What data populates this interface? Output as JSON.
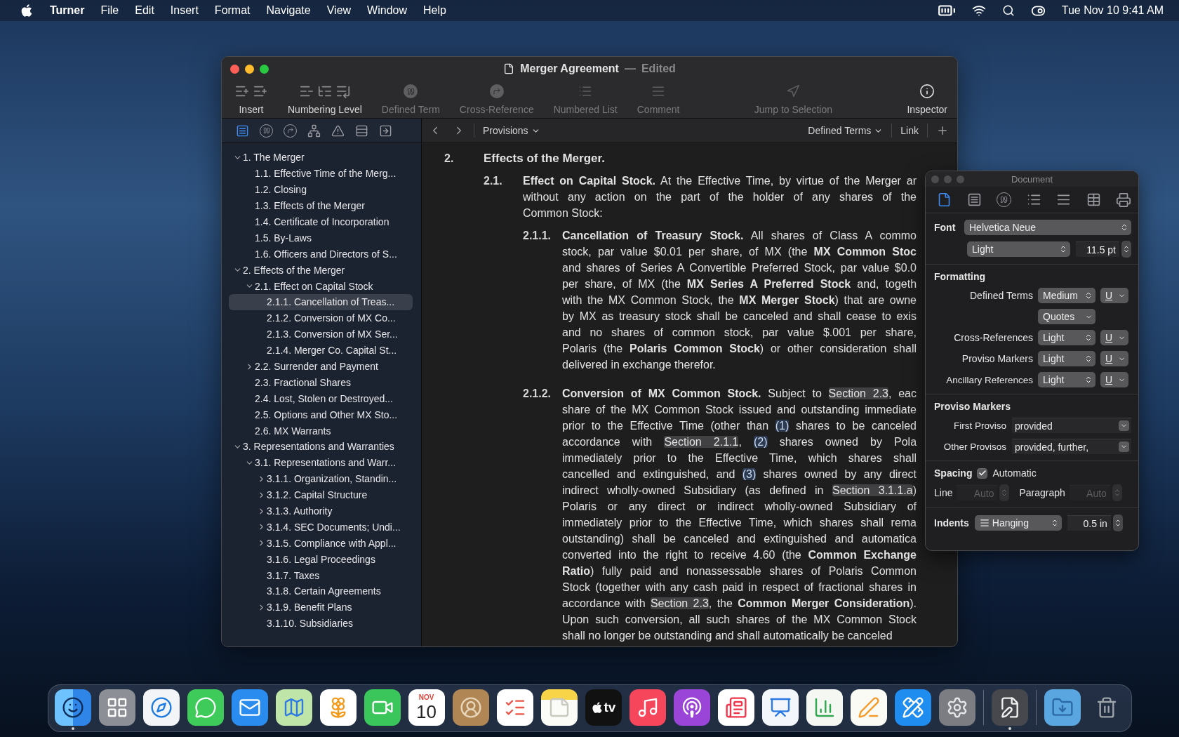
{
  "menu_bar": {
    "app": "Turner",
    "items": [
      "File",
      "Edit",
      "Insert",
      "Format",
      "Navigate",
      "View",
      "Window",
      "Help"
    ],
    "clock": "Tue Nov 10  9:41 AM"
  },
  "window": {
    "title": "Merger Agreement",
    "separator": "—",
    "status": "Edited",
    "toolbar": [
      {
        "kind": "insert",
        "label": "Insert",
        "disabled": false
      },
      {
        "kind": "numbering",
        "label": "Numbering Level",
        "disabled": false
      },
      {
        "kind": "defined_term",
        "label": "Defined Term",
        "disabled": true
      },
      {
        "kind": "cross_reference",
        "label": "Cross-Reference",
        "disabled": true
      },
      {
        "kind": "numbered_list",
        "label": "Numbered List",
        "disabled": true
      },
      {
        "kind": "comment",
        "label": "Comment",
        "disabled": true
      },
      {
        "kind": "jump",
        "label": "Jump to Selection",
        "disabled": true
      },
      {
        "kind": "inspector",
        "label": "Inspector",
        "disabled": false
      }
    ],
    "sidebar_tabs": [
      {
        "kind": "outline",
        "selected": true
      },
      {
        "kind": "quote",
        "selected": false
      },
      {
        "kind": "reference",
        "selected": false
      },
      {
        "kind": "network",
        "selected": false
      },
      {
        "kind": "warning",
        "selected": false
      },
      {
        "kind": "text",
        "selected": false
      },
      {
        "kind": "export",
        "selected": false
      }
    ],
    "nav_bar": {
      "section": "Provisions",
      "filter": "Defined Terms",
      "link": "Link"
    },
    "outline": [
      {
        "label": "1. The Merger",
        "selected": false,
        "expanded": true,
        "children": [
          {
            "label": "1.1. Effective Time of the Merg...",
            "selected": false
          },
          {
            "label": "1.2. Closing",
            "selected": false
          },
          {
            "label": "1.3. Effects of the Merger",
            "selected": false
          },
          {
            "label": "1.4. Certificate of Incorporation",
            "selected": false
          },
          {
            "label": "1.5. By-Laws",
            "selected": false
          },
          {
            "label": "1.6. Officers and Directors of S...",
            "selected": false
          }
        ]
      },
      {
        "label": "2. Effects of the Merger",
        "selected": false,
        "expanded": true,
        "children": [
          {
            "label": "2.1. Effect on Capital Stock",
            "selected": false,
            "expanded": true,
            "children": [
              {
                "label": "2.1.1. Cancellation of Treas...",
                "selected": true
              },
              {
                "label": "2.1.2. Conversion of MX Co...",
                "selected": false
              },
              {
                "label": "2.1.3. Conversion of MX Ser...",
                "selected": false
              },
              {
                "label": "2.1.4. Merger Co. Capital St...",
                "selected": false
              }
            ]
          },
          {
            "label": "2.2. Surrender and Payment",
            "selected": false,
            "expanded": false
          },
          {
            "label": "2.3. Fractional Shares",
            "selected": false
          },
          {
            "label": "2.4. Lost, Stolen or Destroyed...",
            "selected": false
          },
          {
            "label": "2.5. Options and Other MX Sto...",
            "selected": false
          },
          {
            "label": "2.6. MX Warrants",
            "selected": false
          }
        ]
      },
      {
        "label": "3. Representations and Warranties",
        "selected": false,
        "expanded": true,
        "children": [
          {
            "label": "3.1. Representations and Warr...",
            "selected": false,
            "expanded": true,
            "children": [
              {
                "label": "3.1.1. Organization, Standin...",
                "selected": false,
                "expanded": false
              },
              {
                "label": "3.1.2. Capital Structure",
                "selected": false,
                "expanded": false
              },
              {
                "label": "3.1.3. Authority",
                "selected": false,
                "expanded": false
              },
              {
                "label": "3.1.4. SEC Documents; Undi...",
                "selected": false,
                "expanded": false
              },
              {
                "label": "3.1.5. Compliance with Appl...",
                "selected": false,
                "expanded": false
              },
              {
                "label": "3.1.6. Legal Proceedings",
                "selected": false
              },
              {
                "label": "3.1.7. Taxes",
                "selected": false
              },
              {
                "label": "3.1.8. Certain Agreements",
                "selected": false
              },
              {
                "label": "3.1.9. Benefit Plans",
                "selected": false,
                "expanded": false
              },
              {
                "label": "3.1.10. Subsidiaries",
                "selected": false
              }
            ]
          }
        ]
      }
    ],
    "document": [
      {
        "number": "2.",
        "heading": "Effects of the Merger.",
        "children": [
          {
            "number": "2.1.",
            "lines": [
              [
                "**Effect on Capital Stock.** At the Effective Time, by virtue of the Merger ar"
              ],
              [
                "without any action on the part of the holder of any shares of the"
              ],
              [
                "Common Stock:"
              ]
            ],
            "children": [
              {
                "number": "2.1.1.",
                "lines": [
                  [
                    "**Cancellation of Treasury Stock.** All shares of Class A commo"
                  ],
                  [
                    "stock, par value $0.01 per share, of MX (the **MX Common Stoc**"
                  ],
                  [
                    "and shares of Series A Convertible Preferred Stock, par value $0.0"
                  ],
                  [
                    "per share, of MX (the **MX Series A Preferred Stock** and, togeth"
                  ],
                  [
                    "with the MX Common Stock, the **MX Merger Stock**) that are owne"
                  ],
                  [
                    "by MX as treasury stock shall be canceled and shall cease to exis"
                  ],
                  [
                    "and no shares of common stock, par value $.001 per share,"
                  ],
                  [
                    "Polaris (the **Polaris Common Stock**) or other consideration shall"
                  ],
                  [
                    "delivered in exchange therefor."
                  ]
                ]
              },
              {
                "number": "2.1.2.",
                "lines": [
                  [
                    "**Conversion of MX Common Stock.** Subject to ",
                    {
                      "kind": "reference",
                      "text": "Section 2.3"
                    },
                    ", eac"
                  ],
                  [
                    "share of the MX Common Stock issued and outstanding immediate"
                  ],
                  [
                    "prior to the Effective Time (other than ",
                    {
                      "kind": "proviso",
                      "text": "(1)"
                    },
                    " shares to be canceled"
                  ],
                  [
                    "accordance with ",
                    {
                      "kind": "reference",
                      "text": "Section 2.1.1"
                    },
                    ", ",
                    {
                      "kind": "proviso",
                      "text": "(2)"
                    },
                    " shares owned by Pola"
                  ],
                  [
                    "immediately prior to the Effective Time, which shares shall"
                  ],
                  [
                    "cancelled and extinguished, and ",
                    {
                      "kind": "proviso",
                      "text": "(3)"
                    },
                    " shares owned by any direct"
                  ],
                  [
                    "indirect wholly-owned Subsidiary (as defined in ",
                    {
                      "kind": "reference",
                      "text": "Section 3.1.1.a"
                    },
                    ")"
                  ],
                  [
                    "Polaris or any direct or indirect wholly-owned Subsidiary of"
                  ],
                  [
                    "immediately prior to the Effective Time, which shares shall rema"
                  ],
                  [
                    "outstanding) shall be canceled and extinguished and automatica"
                  ],
                  [
                    "converted into the right to receive 4.60 (the **Common Exchange**"
                  ],
                  [
                    "**Ratio**) fully paid and nonassessable shares of Polaris Common"
                  ],
                  [
                    "Stock (together with any cash paid in respect of fractional shares in"
                  ],
                  [
                    "accordance with ",
                    {
                      "kind": "reference",
                      "text": "Section 2.3"
                    },
                    ", the **Common Merger Consideration**)."
                  ],
                  [
                    "Upon such conversion, all such shares of the MX Common Stock"
                  ],
                  [
                    "shall no longer be outstanding and shall automatically be canceled"
                  ]
                ]
              }
            ]
          }
        ]
      }
    ]
  },
  "inspector": {
    "title": "Document",
    "tabs": [
      {
        "kind": "document",
        "selected": true
      },
      {
        "kind": "outline",
        "selected": false
      },
      {
        "kind": "quote",
        "selected": false
      },
      {
        "kind": "list",
        "selected": false
      },
      {
        "kind": "paragraph",
        "selected": false
      },
      {
        "kind": "table",
        "selected": false
      },
      {
        "kind": "print",
        "selected": false
      }
    ],
    "font": {
      "label": "Font",
      "family": "Helvetica Neue",
      "weight": "Light",
      "size": "11.5 pt"
    },
    "formatting": {
      "title": "Formatting",
      "rows": [
        {
          "label": "Defined Terms",
          "weight": "Medium",
          "underline": "U",
          "extra": "Quotes"
        },
        {
          "label": "Cross-References",
          "weight": "Light",
          "underline": "U"
        },
        {
          "label": "Proviso Markers",
          "weight": "Light",
          "underline": "U"
        },
        {
          "label": "Ancillary References",
          "weight": "Light",
          "underline": "U"
        }
      ]
    },
    "proviso": {
      "title": "Proviso Markers",
      "rows": [
        {
          "label": "First Proviso",
          "value": "provided"
        },
        {
          "label": "Other Provisos",
          "value": "provided, further,"
        }
      ]
    },
    "spacing": {
      "title": "Spacing",
      "automatic": {
        "label": "Automatic",
        "checked": true
      },
      "line": {
        "label": "Line",
        "placeholder": "Auto",
        "disabled": true
      },
      "paragraph": {
        "label": "Paragraph",
        "placeholder": "Auto",
        "disabled": true
      }
    },
    "indents": {
      "title": "Indents",
      "style": "Hanging",
      "value": "0.5 in"
    }
  },
  "dock": {
    "apps": [
      {
        "kind": "finder",
        "running": true
      },
      {
        "kind": "launchpad",
        "running": false
      },
      {
        "kind": "safari",
        "running": false
      },
      {
        "kind": "messages",
        "running": false
      },
      {
        "kind": "mail",
        "running": false
      },
      {
        "kind": "maps",
        "running": false
      },
      {
        "kind": "photos",
        "running": false
      },
      {
        "kind": "facetime",
        "running": false
      },
      {
        "kind": "calendar",
        "running": false,
        "month": "NOV",
        "day": "10"
      },
      {
        "kind": "contacts",
        "running": false
      },
      {
        "kind": "reminders",
        "running": false
      },
      {
        "kind": "notes",
        "running": false
      },
      {
        "kind": "tv",
        "running": false,
        "label": "tv"
      },
      {
        "kind": "music",
        "running": false
      },
      {
        "kind": "podcasts",
        "running": false
      },
      {
        "kind": "news",
        "running": false
      },
      {
        "kind": "keynote",
        "running": false
      },
      {
        "kind": "numbers",
        "running": false
      },
      {
        "kind": "pages",
        "running": false
      },
      {
        "kind": "appstore",
        "running": false
      },
      {
        "kind": "settings",
        "running": false
      }
    ],
    "recent": [
      {
        "kind": "turner",
        "running": true
      }
    ],
    "stacks": [
      {
        "kind": "downloads",
        "running": false
      },
      {
        "kind": "trash",
        "running": false
      }
    ]
  }
}
